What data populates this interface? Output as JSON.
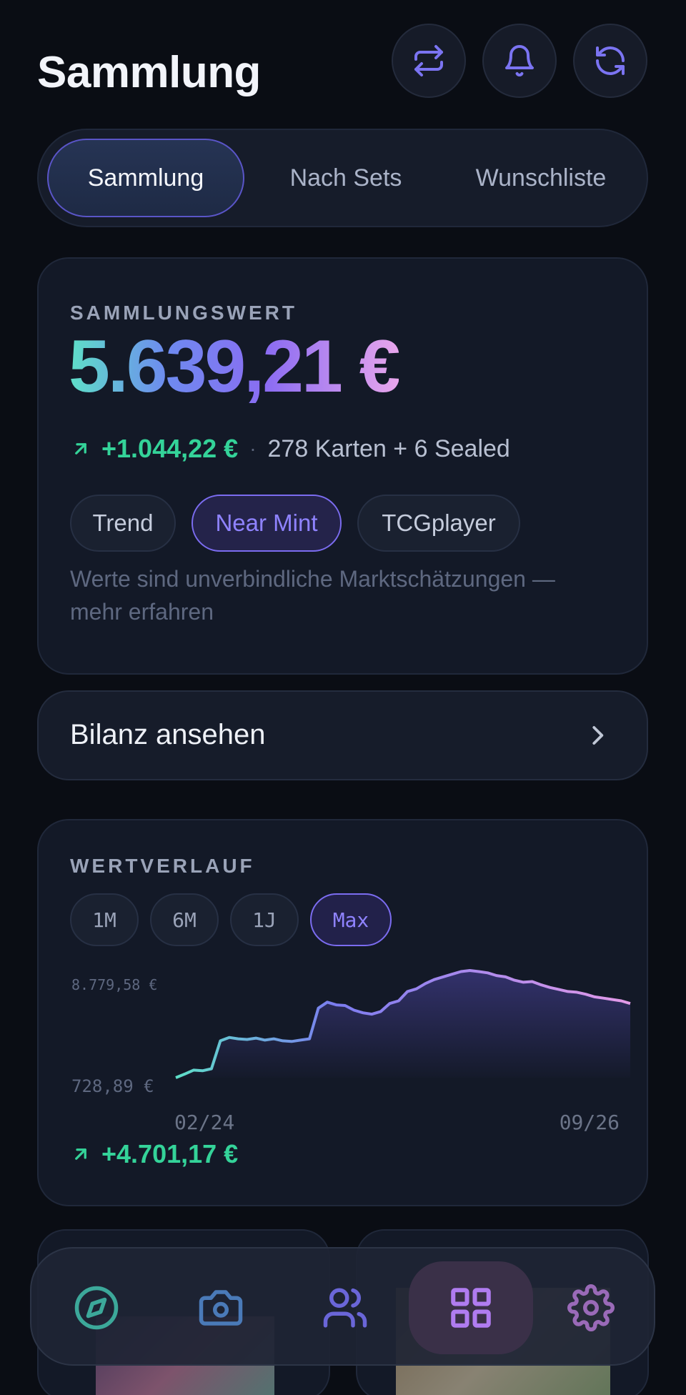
{
  "header": {
    "title": "Sammlung",
    "buttons": [
      {
        "icon": "swap-arrows-icon"
      },
      {
        "icon": "bell-icon"
      },
      {
        "icon": "refresh-icon"
      }
    ]
  },
  "segments": {
    "tabs": [
      {
        "label": "Sammlung",
        "active": true
      },
      {
        "label": "Nach Sets",
        "active": false
      },
      {
        "label": "Wunschliste",
        "active": false
      }
    ]
  },
  "value_card": {
    "eyebrow": "SAMMLUNGSWERT",
    "value": "5.639,21 €",
    "change": "+1.044,22 €",
    "separator": "·",
    "count_text": "278 Karten + 6 Sealed",
    "chips": [
      {
        "label": "Trend",
        "active": false
      },
      {
        "label": "Near Mint",
        "active": true
      },
      {
        "label": "TCGplayer",
        "active": false
      }
    ],
    "note": "Werte sind unverbindliche Marktschätzungen — mehr erfahren"
  },
  "bilanz": {
    "label": "Bilanz ansehen"
  },
  "history_card": {
    "eyebrow": "WERTVERLAUF",
    "ranges": [
      {
        "label": "1M",
        "active": false
      },
      {
        "label": "6M",
        "active": false
      },
      {
        "label": "1J",
        "active": false
      },
      {
        "label": "Max",
        "active": true
      }
    ],
    "y_max_label": "8.779,58 €",
    "y_min_label": "728,89 €",
    "x_start_label": "02/24",
    "x_end_label": "09/26",
    "change": "+4.701,17 €"
  },
  "chart_data": {
    "type": "area",
    "title": "",
    "x_range": [
      "02/24",
      "09/26"
    ],
    "y_ticks": [
      "8.779,58 €",
      "728,89 €"
    ],
    "ylim": [
      728.89,
      8779.58
    ],
    "grid": false,
    "series": [
      {
        "values": [
          728.9,
          1000,
          1300,
          1250,
          1400,
          3500,
          3750,
          3650,
          3600,
          3700,
          3550,
          3650,
          3500,
          3450,
          3550,
          3650,
          5950,
          6400,
          6200,
          6150,
          5800,
          5600,
          5500,
          5700,
          6300,
          6500,
          7200,
          7400,
          7800,
          8100,
          8300,
          8500,
          8700,
          8779.6,
          8700,
          8600,
          8400,
          8300,
          8050,
          7900,
          7950,
          7700,
          7500,
          7350,
          7200,
          7150,
          7000,
          6800,
          6700,
          6600,
          6500,
          6300
        ]
      }
    ],
    "colors": {
      "start": "#5ee0c8",
      "mid": "#7b7cf0",
      "end": "#e39ae8"
    }
  },
  "bottom_nav": {
    "items": [
      {
        "icon": "compass-icon",
        "active": false
      },
      {
        "icon": "camera-icon",
        "active": false
      },
      {
        "icon": "users-icon",
        "active": false
      },
      {
        "icon": "grid-icon",
        "active": true
      },
      {
        "icon": "settings-icon",
        "active": false
      }
    ]
  }
}
